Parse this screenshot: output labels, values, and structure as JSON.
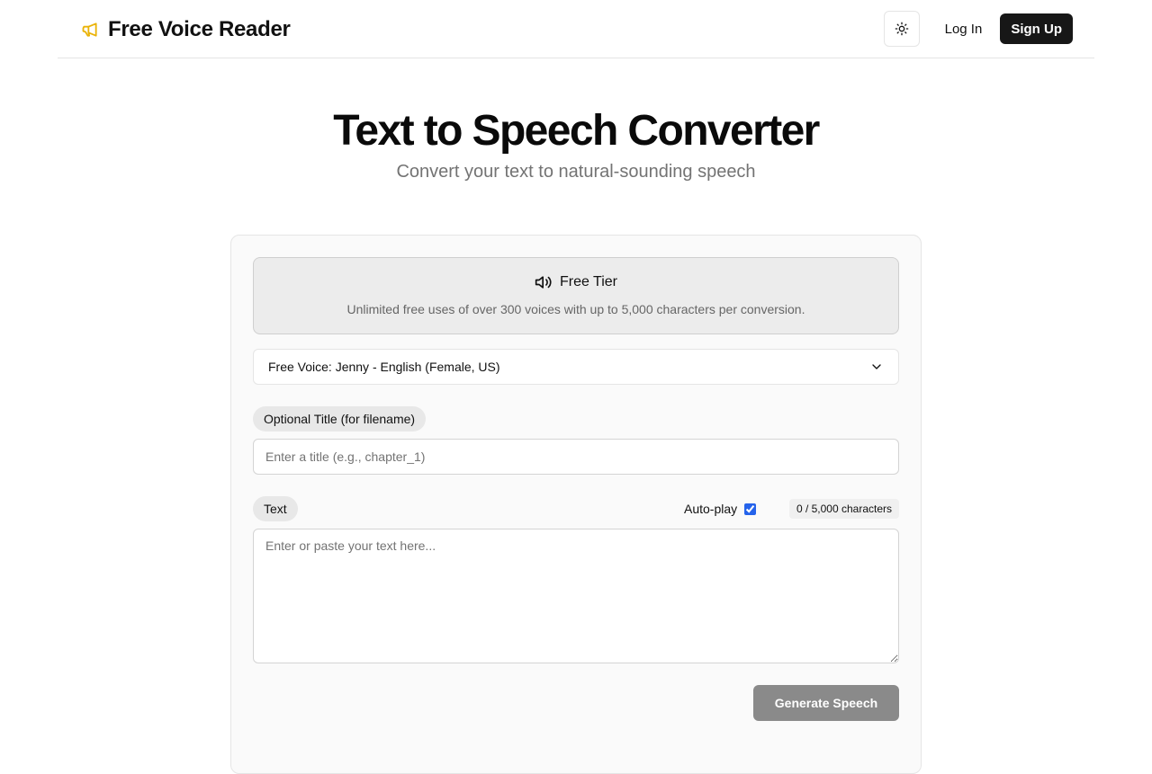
{
  "header": {
    "brand_name": "Free Voice Reader",
    "brand_icon": "megaphone-icon",
    "theme_icon": "sun-icon",
    "login_label": "Log In",
    "signup_label": "Sign Up"
  },
  "hero": {
    "title": "Text to Speech Converter",
    "subtitle": "Convert your text to natural-sounding speech"
  },
  "tier": {
    "icon": "speaker-icon",
    "title": "Free Tier",
    "description": "Unlimited free uses of over 300 voices with up to 5,000 characters per conversion."
  },
  "voice_select": {
    "selected": "Free Voice: Jenny - English (Female, US)"
  },
  "title_field": {
    "label": "Optional Title (for filename)",
    "placeholder": "Enter a title (e.g., chapter_1)",
    "value": ""
  },
  "text_field": {
    "label": "Text",
    "placeholder": "Enter or paste your text here...",
    "value": ""
  },
  "autoplay": {
    "label": "Auto-play",
    "checked": true
  },
  "counter": "0 / 5,000 characters",
  "generate_label": "Generate Speech",
  "colors": {
    "brand_accent": "#eab308",
    "primary_dark": "#171717",
    "disabled_button": "#8a8a8a",
    "checkbox": "#2563eb"
  }
}
